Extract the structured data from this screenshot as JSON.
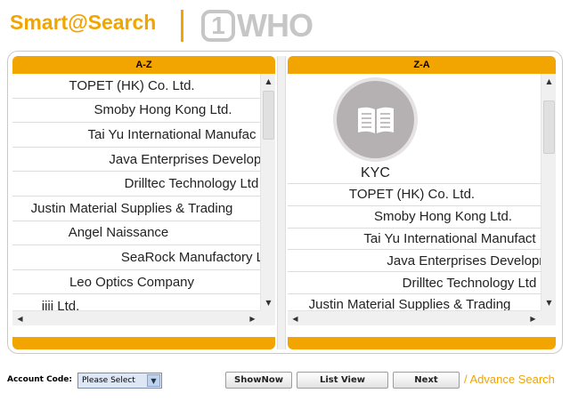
{
  "header": {
    "brand": "Smart@Search",
    "who_number": "1",
    "who_text": "WHO"
  },
  "left_panel": {
    "title": "A-Z",
    "items": [
      "TOPET (HK) Co. Ltd.",
      "Smoby Hong Kong Ltd.",
      "Tai Yu International Manufac",
      "Java Enterprises Developn",
      "Drilltec Technology Ltd",
      "Justin Material Supplies & Trading",
      "Angel Naissance",
      "SeaRock Manufactory Lt",
      "Leo Optics Company",
      "iiii Ltd."
    ]
  },
  "right_panel": {
    "title": "Z-A",
    "kyc_label": "KYC",
    "items": [
      "TOPET (HK) Co. Ltd.",
      "Smoby Hong Kong Ltd.",
      "Tai Yu International Manufact",
      "Java Enterprises Developn",
      "Drilltec Technology Ltd",
      "Justin Material Supplies & Trading"
    ]
  },
  "controls": {
    "account_code_label": "Account Code:",
    "account_code_value": "Please Select",
    "show_now": "ShowNow",
    "list_view": "List View",
    "next": "Next",
    "advance_search": "/ Advance Search"
  },
  "colors": {
    "accent": "#f2a400",
    "logo_grey": "#c6c6c6"
  }
}
